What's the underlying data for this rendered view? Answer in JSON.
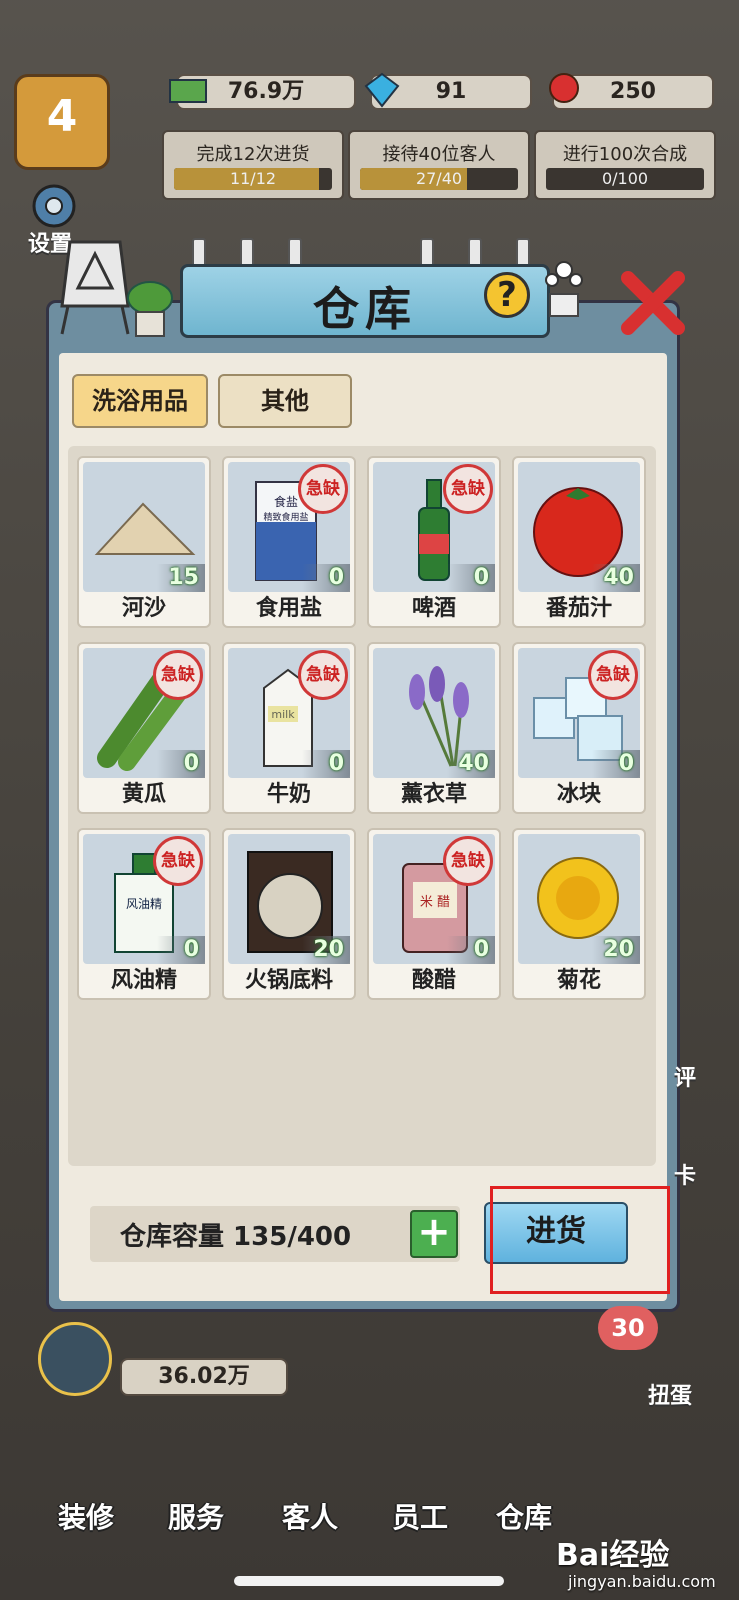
{
  "hud": {
    "level": "4",
    "money": "76.9万",
    "diamonds": "91",
    "roses": "250",
    "settings_label": "设置"
  },
  "tasks": [
    {
      "label": "完成12次进货",
      "progress": "11/12",
      "ratio": 0.917
    },
    {
      "label": "接待40位客人",
      "progress": "27/40",
      "ratio": 0.675
    },
    {
      "label": "进行100次合成",
      "progress": "0/100",
      "ratio": 0.0
    }
  ],
  "warehouse": {
    "title": "仓库",
    "help": "?",
    "tabs": [
      {
        "label": "洗浴用品",
        "active": true
      },
      {
        "label": "其他",
        "active": false
      }
    ],
    "urgent_label": "急缺",
    "items": [
      {
        "name": "河沙",
        "count": "15",
        "urgent": false,
        "icon": "sand-pile-icon"
      },
      {
        "name": "食用盐",
        "count": "0",
        "urgent": true,
        "icon": "salt-bag-icon"
      },
      {
        "name": "啤酒",
        "count": "0",
        "urgent": true,
        "icon": "beer-bottle-icon"
      },
      {
        "name": "番茄汁",
        "count": "40",
        "urgent": false,
        "icon": "tomato-icon"
      },
      {
        "name": "黄瓜",
        "count": "0",
        "urgent": true,
        "icon": "cucumber-icon"
      },
      {
        "name": "牛奶",
        "count": "0",
        "urgent": true,
        "icon": "milk-carton-icon"
      },
      {
        "name": "薰衣草",
        "count": "40",
        "urgent": false,
        "icon": "lavender-icon"
      },
      {
        "name": "冰块",
        "count": "0",
        "urgent": true,
        "icon": "ice-cubes-icon"
      },
      {
        "name": "风油精",
        "count": "0",
        "urgent": true,
        "icon": "oil-bottle-icon"
      },
      {
        "name": "火锅底料",
        "count": "20",
        "urgent": false,
        "icon": "hotpot-base-icon"
      },
      {
        "name": "酸醋",
        "count": "0",
        "urgent": true,
        "icon": "vinegar-jug-icon"
      },
      {
        "name": "菊花",
        "count": "20",
        "urgent": false,
        "icon": "chrysanthemum-icon"
      }
    ],
    "salt_pack_text": "食盐",
    "salt_pack_sub": "精致食用盐",
    "milk_text": "milk",
    "oil_text": "风油精",
    "vinegar_text": "米 醋",
    "capacity_label": "仓库容量 135/400",
    "add_button": "+",
    "restock_button": "进货"
  },
  "bottom": {
    "money": "36.02万",
    "gacha_count": "30",
    "nav": [
      "装修",
      "服务",
      "客人",
      "员工",
      "仓库"
    ],
    "side_labels": [
      "评",
      "卡",
      "扭蛋"
    ]
  },
  "watermark": {
    "main": "Bai经验",
    "sub": "jingyan.baidu.com"
  }
}
